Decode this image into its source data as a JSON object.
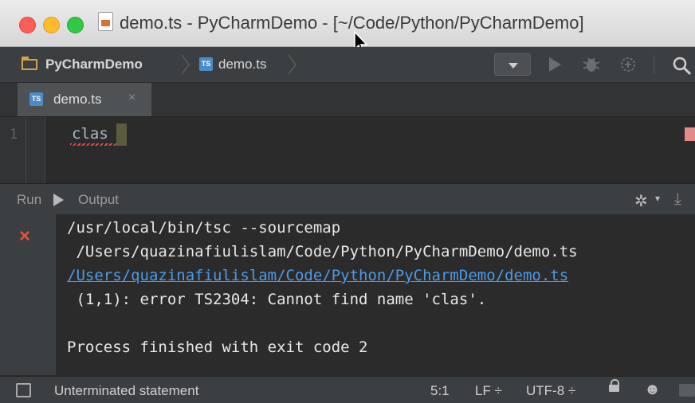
{
  "window": {
    "title": "demo.ts - PyCharmDemo - [~/Code/Python/PyCharmDemo]"
  },
  "breadcrumb": {
    "project": "PyCharmDemo",
    "file": "demo.ts"
  },
  "editor_tab": {
    "label": "demo.ts",
    "close": "×"
  },
  "editor": {
    "line_number": "1",
    "code": "clas"
  },
  "run_panel": {
    "run_label": "Run",
    "output_label": "Output"
  },
  "console": {
    "lines": [
      "/usr/local/bin/tsc --sourcemap",
      " /Users/quazinafiulislam/Code/Python/PyCharmDemo/demo.ts",
      "/Users/quazinafiulislam/Code/Python/PyCharmDemo/demo.ts",
      " (1,1): error TS2304: Cannot find name 'clas'.",
      "",
      "Process finished with exit code 2"
    ]
  },
  "statusbar": {
    "message": "Unterminated statement",
    "position": "5:1",
    "line_separator": "LF ÷",
    "encoding": "UTF-8 ÷"
  },
  "icons": {
    "close_icon": "×",
    "gear_icon": "✲"
  },
  "colors": {
    "error": "#e2543a",
    "link": "#4a9bea",
    "background": "#2b2b2b"
  }
}
